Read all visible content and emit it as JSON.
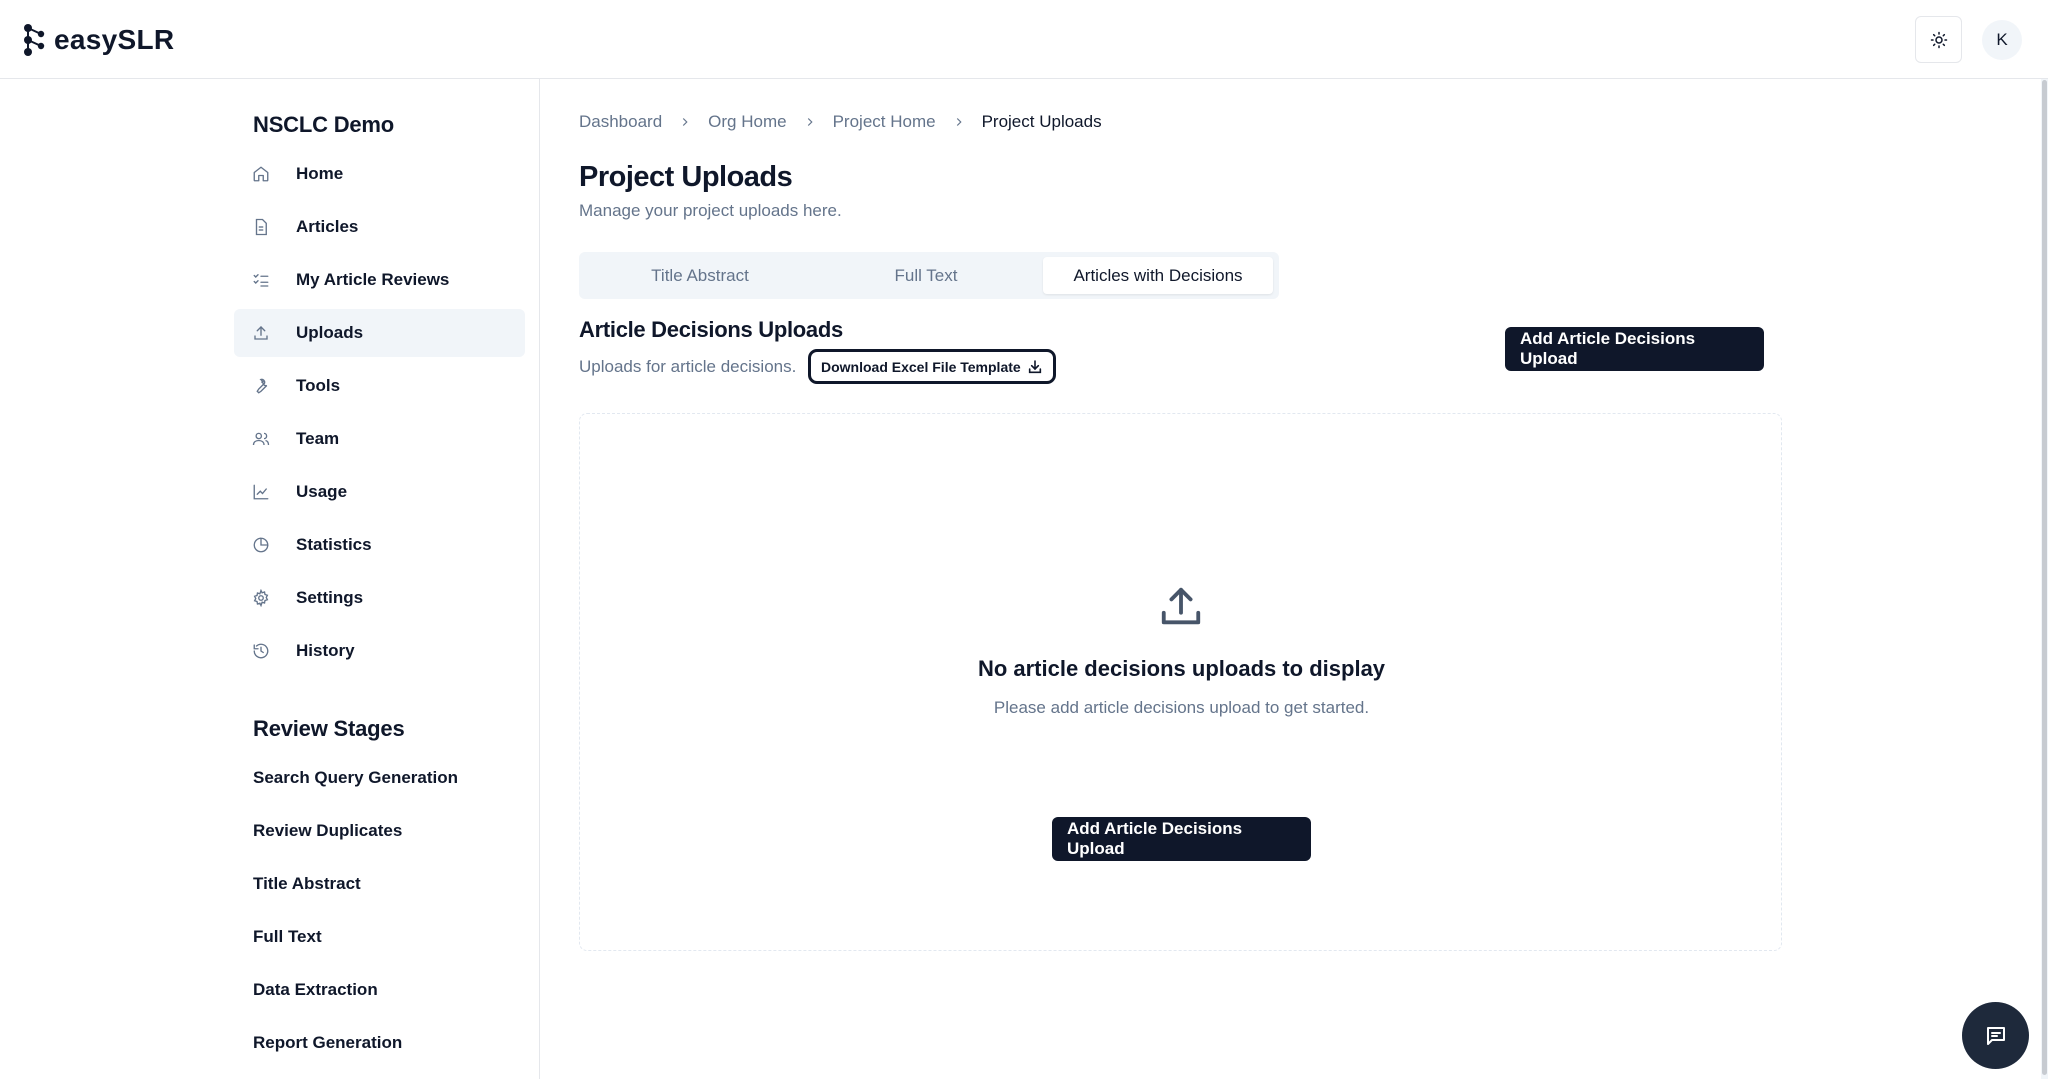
{
  "app": {
    "name": "easySLR",
    "avatar_initial": "K"
  },
  "sidebar": {
    "project_title": "NSCLC Demo",
    "items": [
      {
        "label": "Home",
        "icon": "home-icon"
      },
      {
        "label": "Articles",
        "icon": "document-icon"
      },
      {
        "label": "My Article Reviews",
        "icon": "checklist-icon"
      },
      {
        "label": "Uploads",
        "icon": "upload-icon",
        "active": true
      },
      {
        "label": "Tools",
        "icon": "wrench-icon"
      },
      {
        "label": "Team",
        "icon": "users-icon"
      },
      {
        "label": "Usage",
        "icon": "line-chart-icon"
      },
      {
        "label": "Statistics",
        "icon": "pie-chart-icon"
      },
      {
        "label": "Settings",
        "icon": "gear-icon"
      },
      {
        "label": "History",
        "icon": "history-icon"
      }
    ],
    "stages_title": "Review Stages",
    "stages": [
      "Search Query Generation",
      "Review Duplicates",
      "Title Abstract",
      "Full Text",
      "Data Extraction",
      "Report Generation"
    ]
  },
  "breadcrumb": [
    "Dashboard",
    "Org Home",
    "Project Home",
    "Project Uploads"
  ],
  "page": {
    "title": "Project Uploads",
    "subtitle": "Manage your project uploads here."
  },
  "tabs": [
    {
      "label": "Title Abstract",
      "active": false
    },
    {
      "label": "Full Text",
      "active": false
    },
    {
      "label": "Articles with Decisions",
      "active": true
    }
  ],
  "section": {
    "title": "Article Decisions Uploads",
    "subtitle": "Uploads for article decisions.",
    "download_label": "Download Excel File Template",
    "add_label": "Add Article Decisions Upload"
  },
  "empty_state": {
    "title": "No article decisions uploads to display",
    "subtitle": "Please add article decisions upload to get started.",
    "button_label": "Add Article Decisions Upload"
  },
  "colors": {
    "primary": "#0f172a",
    "muted": "#64748b",
    "border": "#e5e7eb",
    "active_bg": "#f1f5f9"
  }
}
